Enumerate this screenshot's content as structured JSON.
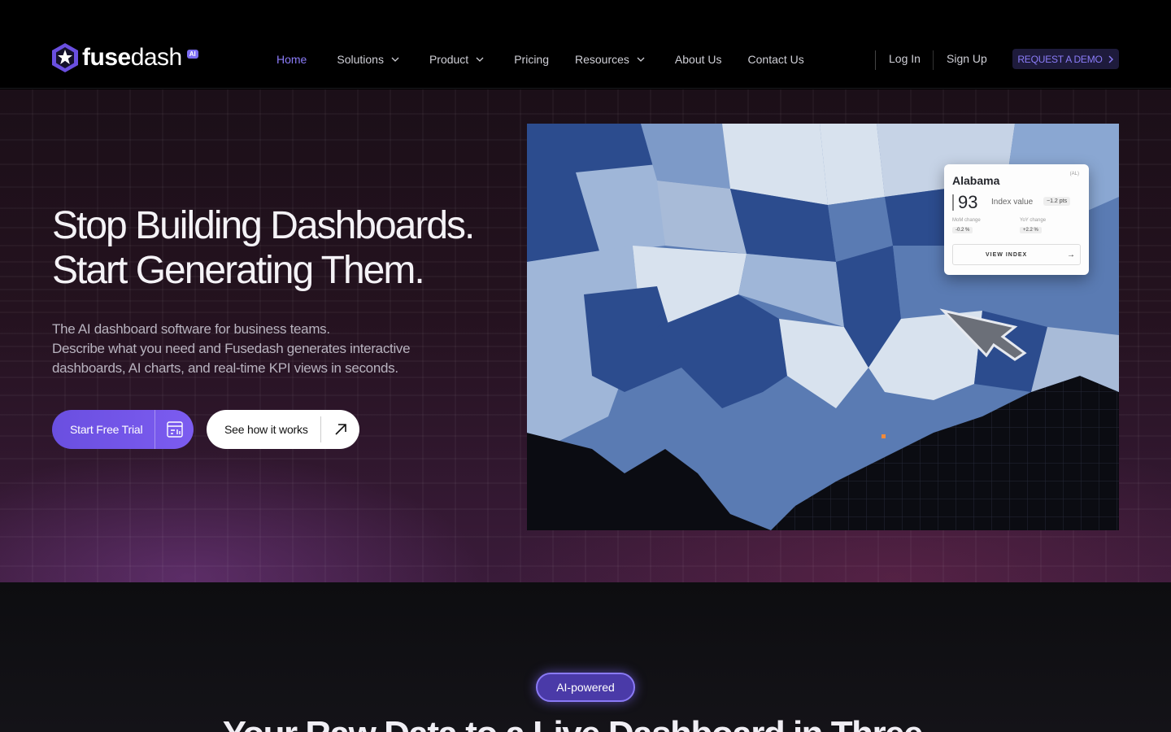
{
  "brand": {
    "name_part1": "fuse",
    "name_part2": "dash",
    "badge": "AI"
  },
  "nav": {
    "links": [
      {
        "label": "Home",
        "active": true,
        "dropdown": false
      },
      {
        "label": "Solutions",
        "active": false,
        "dropdown": true
      },
      {
        "label": "Product",
        "active": false,
        "dropdown": true
      },
      {
        "label": "Pricing",
        "active": false,
        "dropdown": false
      },
      {
        "label": "Resources",
        "active": false,
        "dropdown": true
      },
      {
        "label": "About Us",
        "active": false,
        "dropdown": false
      },
      {
        "label": "Contact Us",
        "active": false,
        "dropdown": false
      }
    ],
    "login": "Log In",
    "signup": "Sign Up",
    "demo": "REQUEST A DEMO"
  },
  "hero": {
    "headline_line1": "Stop Building Dashboards.",
    "headline_line2": "Start Generating Them.",
    "sub_line1": "The AI dashboard software for business teams.",
    "sub_line2": "Describe what you need and Fusedash generates interactive dashboards, AI charts, and real-time KPI views in seconds.",
    "cta_primary": "Start Free Trial",
    "cta_secondary": "See how it works"
  },
  "map_card": {
    "state": "Alabama",
    "abbr": "(AL)",
    "value": "93",
    "value_label": "Index value",
    "change_pts": "−1.2 pts",
    "mom_label": "MoM change",
    "mom_value": "-0.2 %",
    "yoy_label": "YoY change",
    "yoy_value": "+2.2 %",
    "button": "VIEW INDEX"
  },
  "section2": {
    "badge": "AI-powered",
    "title": "Your Raw Data to a Live Dashboard in Three..."
  },
  "colors": {
    "accent": "#8b7cf8",
    "primary_button": "#6a4fe0",
    "nav_bg": "#000000"
  },
  "icons": [
    "chevron-down-icon",
    "chevron-right-icon",
    "dashboard-icon",
    "arrow-up-right-icon",
    "arrow-right-icon",
    "logo-icon"
  ]
}
